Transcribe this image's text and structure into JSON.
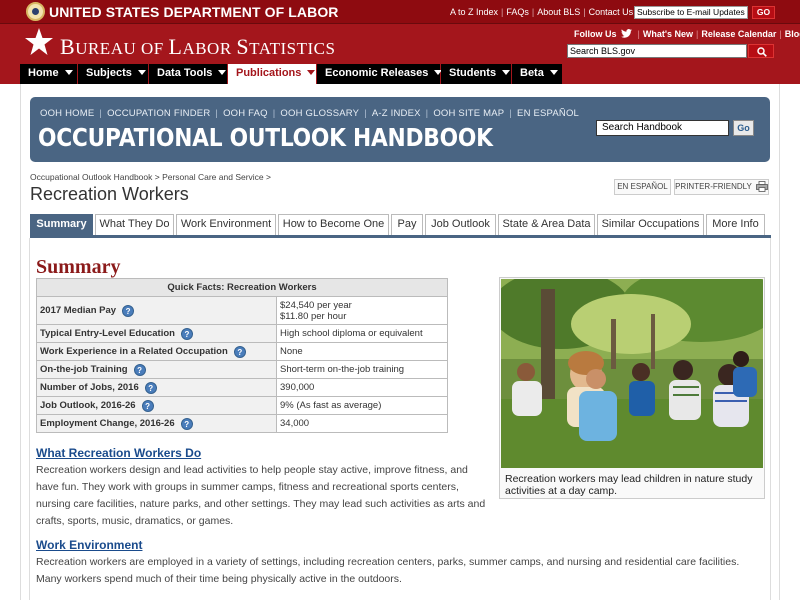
{
  "dol": {
    "name": "UNITED STATES DEPARTMENT OF LABOR",
    "links": [
      "A to Z Index",
      "FAQs",
      "About BLS",
      "Contact Us"
    ],
    "email_placeholder": "Subscribe to E-mail Updates",
    "go_label": "GO"
  },
  "bls": {
    "title_b": "B",
    "title_ureau": "UREAU OF ",
    "title_l": "L",
    "title_abor": "ABOR ",
    "title_s": "S",
    "title_tatistics": "TATISTICS",
    "follow_label": "Follow Us",
    "whats_new": "What's New",
    "release_calendar": "Release Calendar",
    "blog": "Blog",
    "search_placeholder": "Search BLS.gov"
  },
  "nav": [
    "Home",
    "Subjects",
    "Data Tools",
    "Publications",
    "Economic Releases",
    "Students",
    "Beta"
  ],
  "ooh": {
    "nav": [
      "OOH HOME",
      "OCCUPATION FINDER",
      "OOH FAQ",
      "OOH GLOSSARY",
      "A-Z INDEX",
      "OOH SITE MAP",
      "EN ESPAÑOL"
    ],
    "title": "OCCUPATIONAL OUTLOOK HANDBOOK",
    "search_placeholder": "Search Handbook",
    "go_label": "Go"
  },
  "breadcrumb": [
    "Occupational Outlook Handbook",
    "Personal Care and Service"
  ],
  "page_title": "Recreation Workers",
  "tools": {
    "espanol": "EN ESPAÑOL",
    "printer": "PRINTER-FRIENDLY"
  },
  "tabs": [
    "Summary",
    "What They Do",
    "Work Environment",
    "How to Become One",
    "Pay",
    "Job Outlook",
    "State & Area Data",
    "Similar Occupations",
    "More Info"
  ],
  "summary": {
    "heading": "Summary",
    "facts_title": "Quick Facts: Recreation Workers",
    "facts": [
      {
        "label": "2017 Median Pay",
        "value": "$24,540 per year",
        "value2": "$11.80 per hour"
      },
      {
        "label": "Typical Entry-Level Education",
        "value": "High school diploma or equivalent"
      },
      {
        "label": "Work Experience in a Related Occupation",
        "value": "None"
      },
      {
        "label": "On-the-job Training",
        "value": "Short-term on-the-job training"
      },
      {
        "label": "Number of Jobs, 2016",
        "value": "390,000"
      },
      {
        "label": "Job Outlook, 2016-26",
        "value": "9% (As fast as average)"
      },
      {
        "label": "Employment Change, 2016-26",
        "value": "34,000"
      }
    ],
    "help_glyph": "?",
    "photo_caption": "Recreation workers may lead children in nature study activities at a day camp.",
    "what_heading": "What Recreation Workers Do",
    "what_text": "Recreation workers design and lead activities to help people stay active, improve fitness, and have fun. They work with groups in summer camps, fitness and recreational sports centers, nursing care facilities, nature parks, and other settings. They may lead such activities as arts and crafts, sports, music, dramatics, or games.",
    "env_heading": "Work Environment",
    "env_text": "Recreation workers are employed in a variety of settings, including recreation centers, parks, summer camps, and nursing and residential care facilities. Many workers spend much of their time being physically active in the outdoors."
  },
  "colors": {
    "bls_red": "#a4161c",
    "ooh_blue": "#4a6583",
    "link_blue": "#1a4b8c",
    "heading_red": "#8b1a1a"
  }
}
